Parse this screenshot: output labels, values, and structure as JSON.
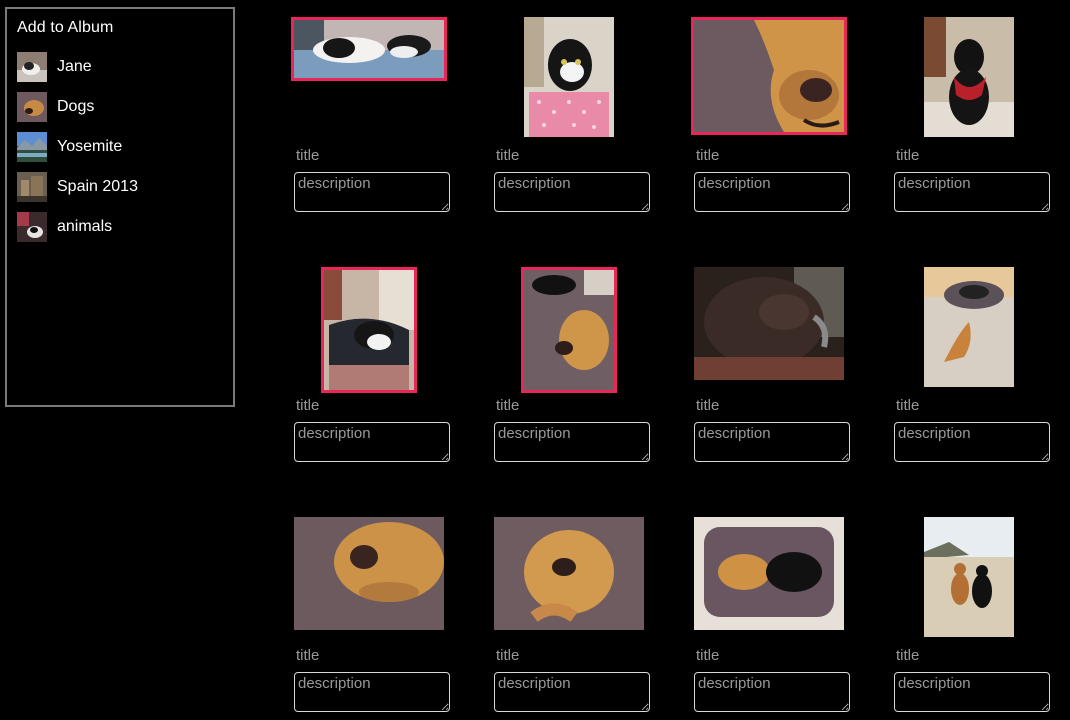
{
  "sidebar": {
    "heading": "Add to Album",
    "albums": [
      {
        "label": "Jane",
        "thumb": "cat-thumbnail"
      },
      {
        "label": "Dogs",
        "thumb": "dog-thumbnail"
      },
      {
        "label": "Yosemite",
        "thumb": "landscape-thumbnail"
      },
      {
        "label": "Spain 2013",
        "thumb": "building-thumbnail"
      },
      {
        "label": "animals",
        "thumb": "animals-thumbnail"
      }
    ]
  },
  "grid": {
    "title_placeholder": "title",
    "description_placeholder": "description",
    "photos": [
      {
        "subject": "cats sleeping on bed",
        "selected": true
      },
      {
        "subject": "black-and-white cat with pink box",
        "selected": false
      },
      {
        "subject": "dog nose closeup",
        "selected": true
      },
      {
        "subject": "black dog with red bandana",
        "selected": false
      },
      {
        "subject": "cat in bag",
        "selected": true
      },
      {
        "subject": "dog lying on cushion",
        "selected": true
      },
      {
        "subject": "fluffy dark dog",
        "selected": false
      },
      {
        "subject": "dog lying on floor",
        "selected": false
      },
      {
        "subject": "dog face on cushion",
        "selected": false
      },
      {
        "subject": "dog upside down on cushion",
        "selected": false
      },
      {
        "subject": "two dogs on bed",
        "selected": false
      },
      {
        "subject": "two dogs on beach",
        "selected": false
      }
    ]
  },
  "colors": {
    "background": "#000000",
    "selection_border": "#e8265a",
    "panel_border": "#7a7a7a",
    "placeholder_text": "#9a9a9a"
  }
}
